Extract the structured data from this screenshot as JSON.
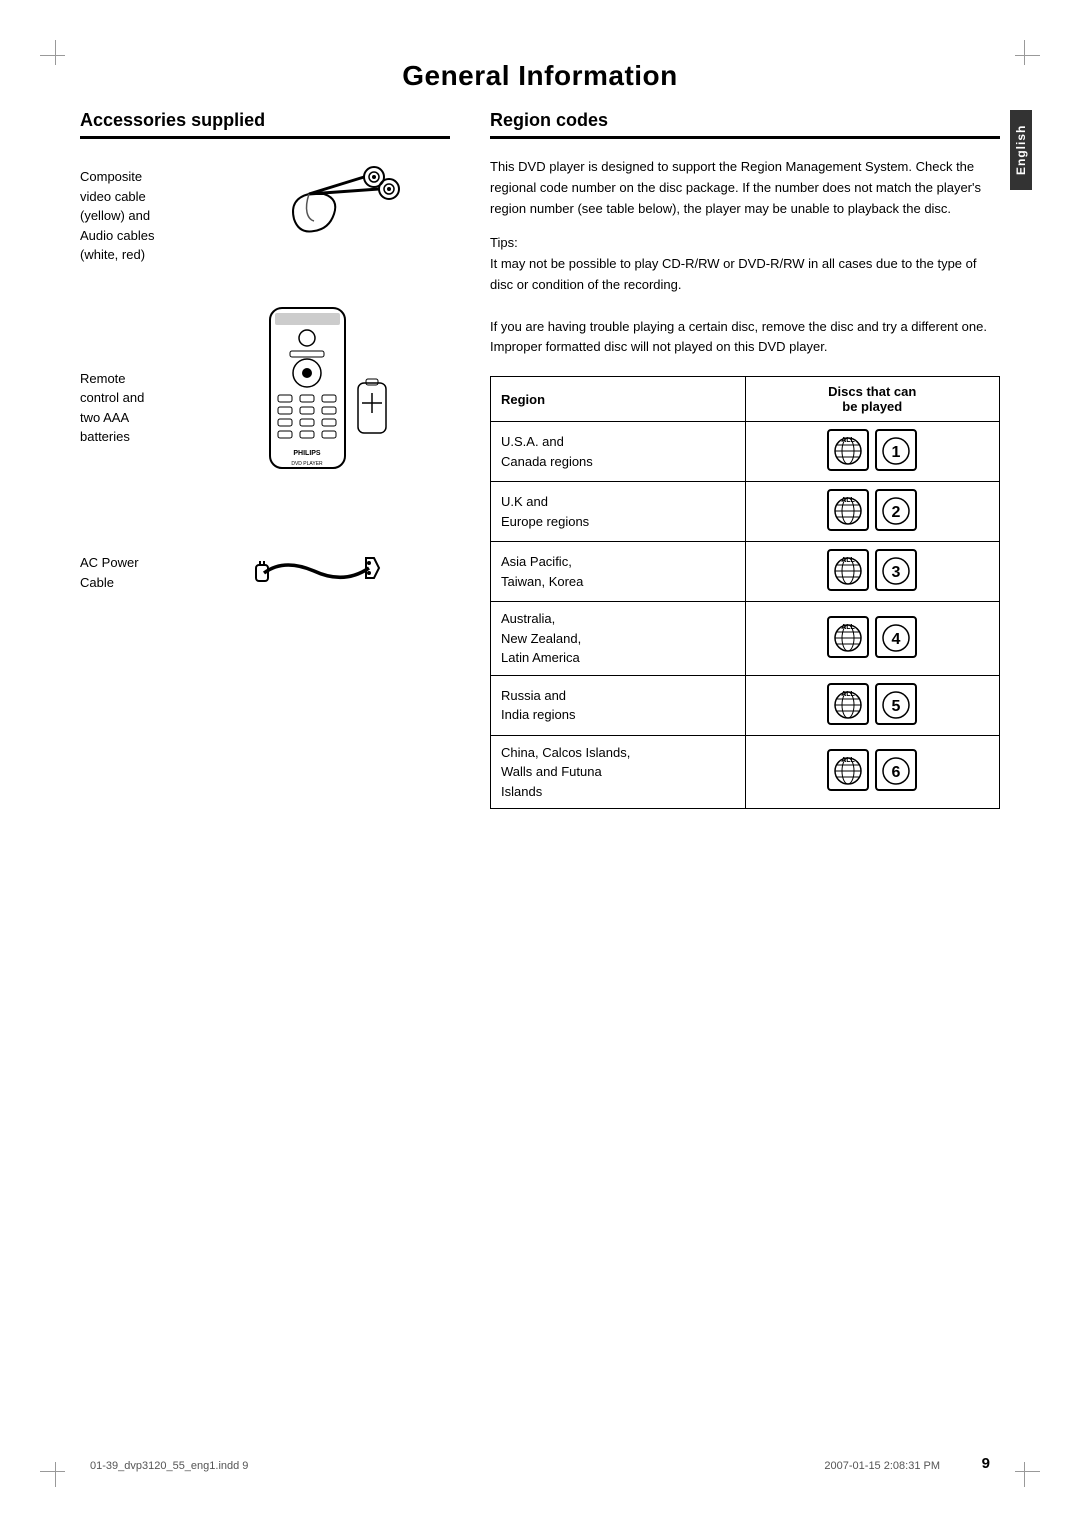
{
  "page": {
    "title": "General Information",
    "page_number": "9",
    "footer_left": "01-39_dvp3120_55_eng1.indd 9",
    "footer_right": "2007-01-15  2:08:31 PM"
  },
  "left_section": {
    "heading": "Accessories supplied",
    "accessories": [
      {
        "label": "Composite\nvideo cable\n(yellow) and\nAudio cables\n(white, red)",
        "type": "cable"
      },
      {
        "label": "Remote\ncontrol and\ntwo AAA\nbatteries",
        "type": "remote"
      },
      {
        "label": "AC Power\nCable",
        "type": "power"
      }
    ]
  },
  "right_section": {
    "heading": "Region codes",
    "body_text": "This DVD player is designed to support the Region Management System. Check the regional code number on the disc package. If the number does not match the player's region number (see table below), the player may be unable to playback the disc.",
    "tips_label": "Tips:",
    "tip1": "It may not be possible to play CD-R/RW or DVD-R/RW in all cases due to the type of disc or condition of the recording.",
    "tip2": "If you are having trouble playing a certain disc, remove the disc and try a different one. Improper formatted disc will not played on this DVD player.",
    "table": {
      "col1_header": "Region",
      "col2_header": "Discs that can\nbe played",
      "rows": [
        {
          "region": "U.S.A. and\nCanada regions",
          "number": "1"
        },
        {
          "region": "U.K and\nEurope regions",
          "number": "2"
        },
        {
          "region": "Asia Pacific,\nTaiwan, Korea",
          "number": "3"
        },
        {
          "region": "Australia,\nNew Zealand,\nLatin America",
          "number": "4"
        },
        {
          "region": "Russia and\nIndia regions",
          "number": "5"
        },
        {
          "region": "China, Calcos Islands,\nWalls and Futuna\nIslands",
          "number": "6"
        }
      ]
    }
  },
  "language_tab": "English"
}
